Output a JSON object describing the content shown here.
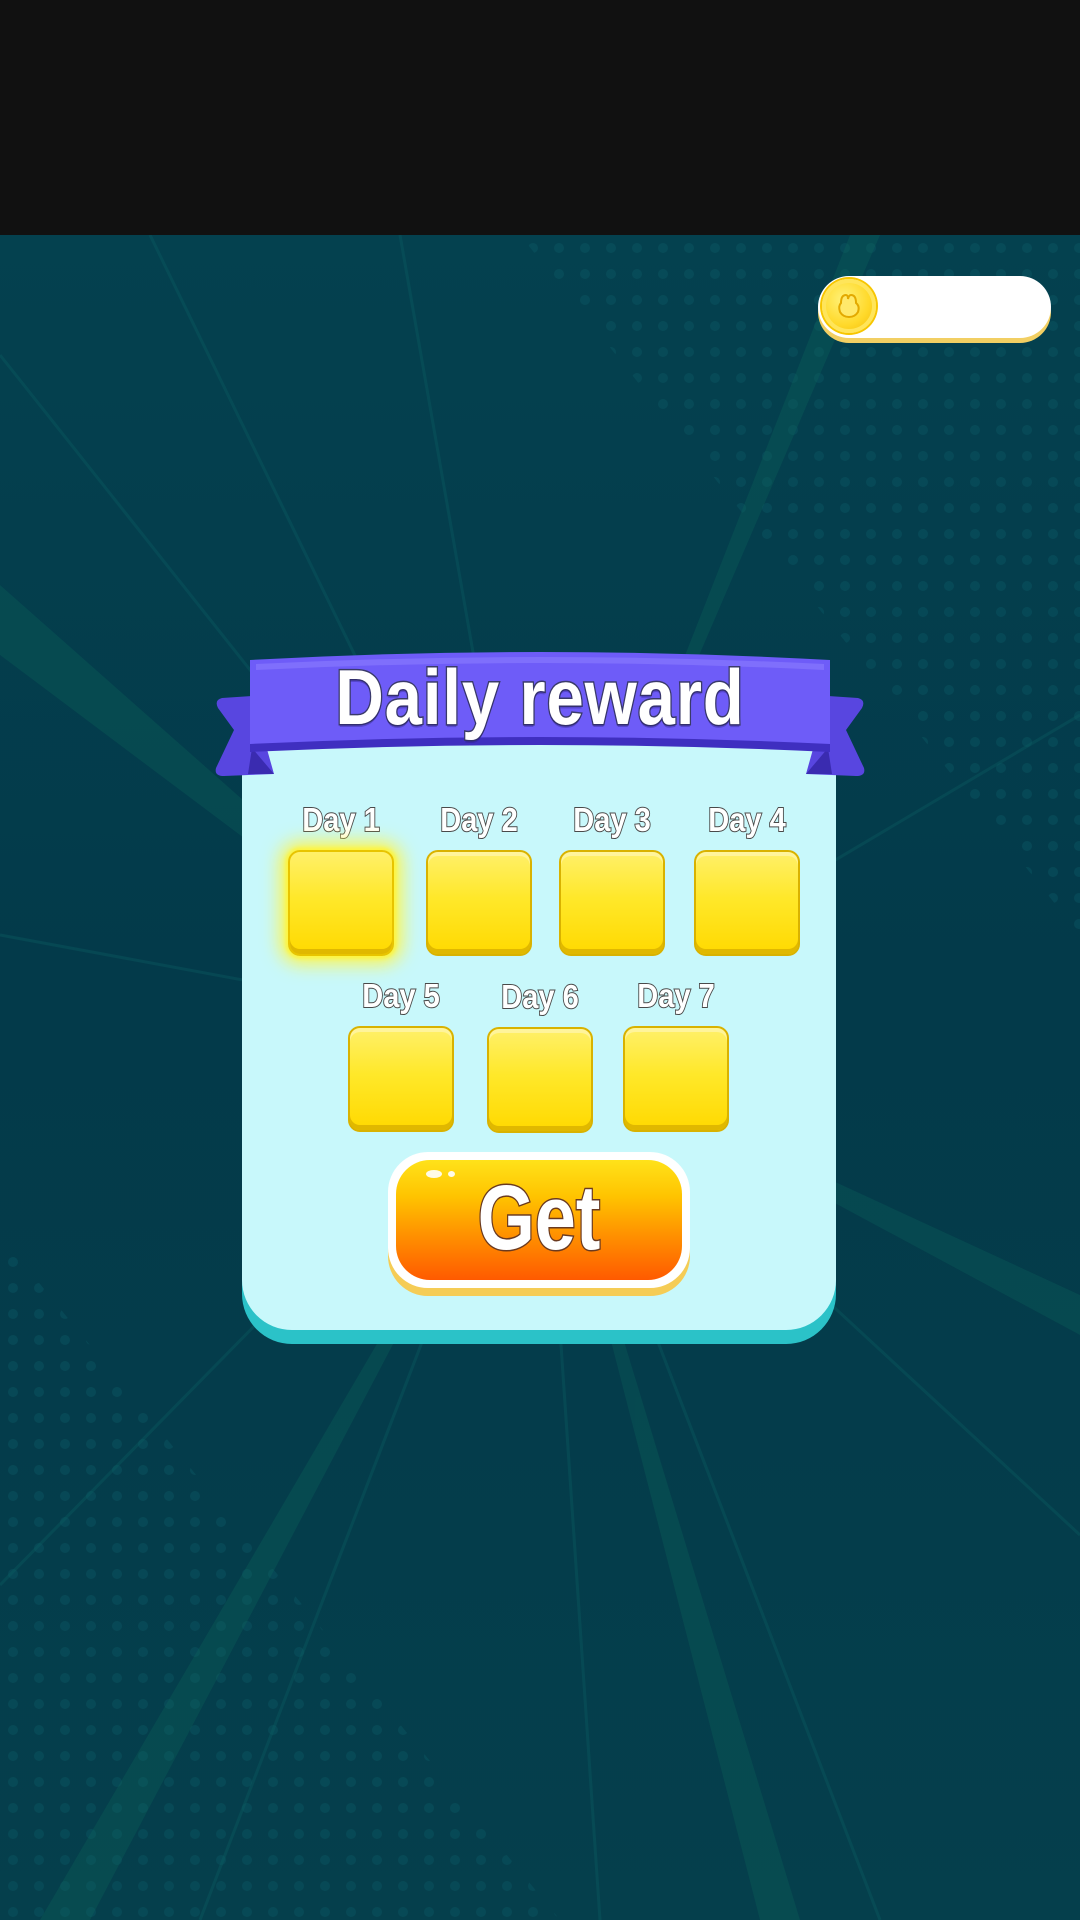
{
  "header": {
    "coin_icon": "coin-icon",
    "coin_value": ""
  },
  "dialog": {
    "title": "Daily reward",
    "days": [
      {
        "label": "Day 1",
        "state": "active"
      },
      {
        "label": "Day 2",
        "state": "locked"
      },
      {
        "label": "Day 3",
        "state": "locked"
      },
      {
        "label": "Day 4",
        "state": "locked"
      },
      {
        "label": "Day 5",
        "state": "locked"
      },
      {
        "label": "Day 6",
        "state": "locked"
      },
      {
        "label": "Day 7",
        "state": "locked"
      }
    ],
    "get_button_label": "Get"
  },
  "colors": {
    "background": "#033a4a",
    "panel": "#c8f8fb",
    "ribbon": "#6b5ff7",
    "reward_box": "#ffe600",
    "button_top": "#ffe21a",
    "button_bottom": "#ff5a00",
    "panel_shadow": "#2bc2c8"
  }
}
